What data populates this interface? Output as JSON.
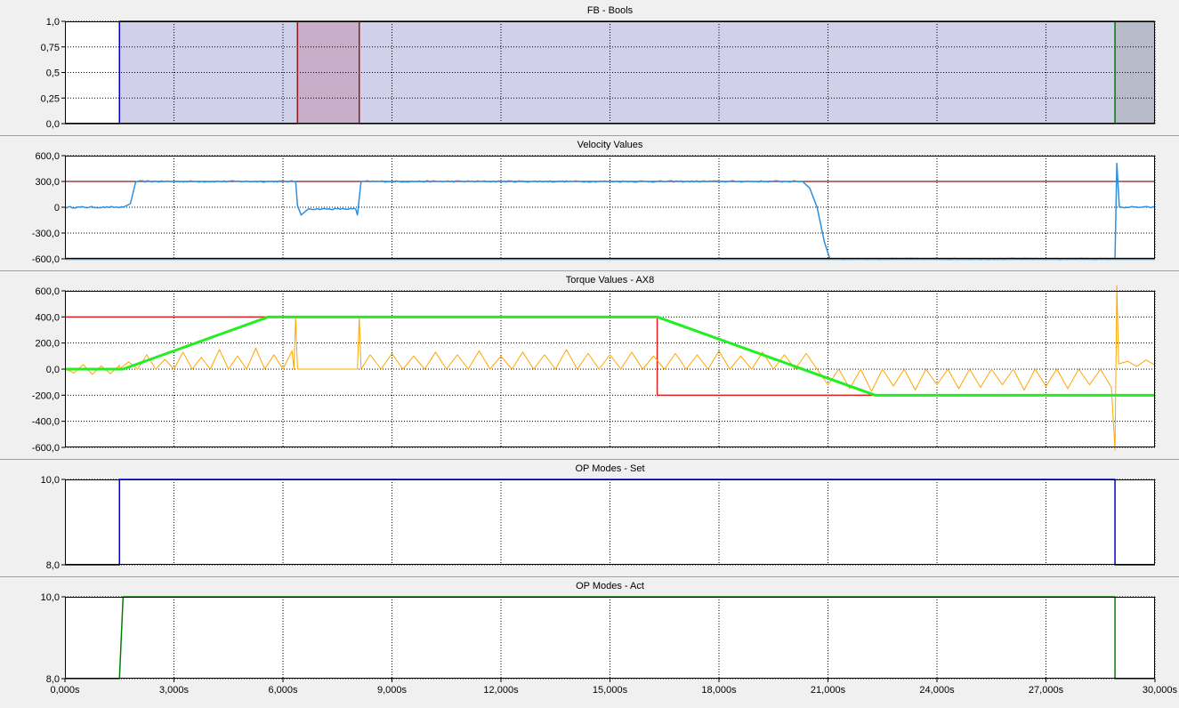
{
  "x_axis": {
    "range": [
      0,
      30
    ],
    "ticks": [
      0,
      3,
      6,
      9,
      12,
      15,
      18,
      21,
      24,
      27,
      30
    ],
    "tick_labels": [
      "0,000s",
      "3,000s",
      "6,000s",
      "9,000s",
      "12,000s",
      "15,000s",
      "18,000s",
      "21,000s",
      "24,000s",
      "27,000s",
      "30,000s"
    ]
  },
  "colors": {
    "panel_bg": "#f0f0f0",
    "plot_bg": "#ffffff",
    "grid": "#000000",
    "blue": "#0000cc",
    "dark_red": "#8b1a1a",
    "green": "#008000",
    "light_blue": "#2a8fe0",
    "red": "#e02020",
    "bright_green": "#22ee22",
    "orange": "#ffa500"
  },
  "chart_data": [
    {
      "type": "line",
      "title": "FB - Bools",
      "ylim": [
        0,
        1
      ],
      "yticks": [
        0,
        0.25,
        0.5,
        0.75,
        1
      ],
      "ytick_labels": [
        "0,0",
        "0,25",
        "0,5",
        "0,75",
        "1,0"
      ],
      "grid": true,
      "series": [
        {
          "color": "blue",
          "fill": "#c8c8e6",
          "points": [
            [
              0,
              0
            ],
            [
              1.5,
              0
            ],
            [
              1.5,
              1
            ],
            [
              30,
              1
            ]
          ]
        },
        {
          "color": "dark_red",
          "fill": "#c8a8c4",
          "points": [
            [
              0,
              0
            ],
            [
              6.4,
              0
            ],
            [
              6.4,
              1
            ],
            [
              8.1,
              1
            ],
            [
              8.1,
              0
            ],
            [
              30,
              0
            ]
          ]
        },
        {
          "color": "green",
          "fill": "#b4b8c4",
          "points": [
            [
              0,
              0
            ],
            [
              28.9,
              0
            ],
            [
              28.9,
              1
            ],
            [
              30,
              1
            ]
          ]
        }
      ]
    },
    {
      "type": "line",
      "title": "Velocity Values",
      "ylim": [
        -600,
        600
      ],
      "yticks": [
        -600,
        -300,
        0,
        300,
        600
      ],
      "ytick_labels": [
        "-600,0",
        "-300,0",
        "0",
        "300,0",
        "600,0"
      ],
      "grid": true,
      "series": [
        {
          "color": "dark_red",
          "width": 1.2,
          "points": [
            [
              0,
              300
            ],
            [
              30,
              300
            ]
          ]
        },
        {
          "color": "light_blue",
          "width": 2.5,
          "points": [
            [
              0,
              -600
            ],
            [
              30,
              -600
            ]
          ]
        },
        {
          "color": "light_blue",
          "width": 1.5,
          "noise": 8,
          "points": [
            [
              0,
              0
            ],
            [
              1.6,
              0
            ],
            [
              1.8,
              40
            ],
            [
              1.95,
              300
            ],
            [
              6.35,
              300
            ],
            [
              6.4,
              20
            ],
            [
              6.5,
              -90
            ],
            [
              6.7,
              -20
            ],
            [
              8,
              -20
            ],
            [
              8.05,
              -90
            ],
            [
              8.15,
              300
            ],
            [
              20.3,
              300
            ],
            [
              20.5,
              220
            ],
            [
              20.7,
              0
            ],
            [
              20.9,
              -400
            ],
            [
              21.05,
              -600
            ],
            [
              28.9,
              -600
            ],
            [
              28.95,
              510
            ],
            [
              29.02,
              0
            ],
            [
              30,
              0
            ]
          ]
        }
      ]
    },
    {
      "type": "line",
      "title": "Torque Values - AX8",
      "ylim": [
        -600,
        600
      ],
      "yticks": [
        -600,
        -400,
        -200,
        0,
        200,
        400,
        600
      ],
      "ytick_labels": [
        "-600,0",
        "-400,0",
        "-200,0",
        "0,0",
        "200,0",
        "400,0",
        "600,0"
      ],
      "grid": true,
      "series": [
        {
          "color": "red",
          "width": 1.5,
          "points": [
            [
              0,
              400
            ],
            [
              16.3,
              400
            ],
            [
              16.3,
              -200
            ],
            [
              30,
              -200
            ]
          ]
        },
        {
          "color": "orange",
          "width": 1,
          "points": [
            [
              0,
              5
            ],
            [
              0.25,
              -30
            ],
            [
              0.5,
              35
            ],
            [
              0.75,
              -40
            ],
            [
              1,
              25
            ],
            [
              1.25,
              -35
            ],
            [
              1.5,
              30
            ],
            [
              1.5,
              0
            ],
            [
              1.75,
              55
            ],
            [
              2,
              0
            ],
            [
              2.25,
              110
            ],
            [
              2.5,
              0
            ],
            [
              2.75,
              75
            ],
            [
              3,
              0
            ],
            [
              3.25,
              130
            ],
            [
              3.5,
              0
            ],
            [
              3.75,
              90
            ],
            [
              4,
              0
            ],
            [
              4.25,
              150
            ],
            [
              4.5,
              0
            ],
            [
              4.75,
              100
            ],
            [
              5,
              0
            ],
            [
              5.25,
              160
            ],
            [
              5.5,
              0
            ],
            [
              5.75,
              110
            ],
            [
              6,
              0
            ],
            [
              6.25,
              140
            ],
            [
              6.3,
              0
            ],
            [
              6.35,
              400
            ],
            [
              6.4,
              0
            ],
            [
              8.05,
              0
            ],
            [
              8.1,
              400
            ],
            [
              8.15,
              0
            ],
            [
              8.4,
              110
            ],
            [
              8.7,
              0
            ],
            [
              9,
              120
            ],
            [
              9.3,
              0
            ],
            [
              9.6,
              100
            ],
            [
              9.9,
              0
            ],
            [
              10.2,
              130
            ],
            [
              10.5,
              0
            ],
            [
              10.8,
              110
            ],
            [
              11.1,
              0
            ],
            [
              11.4,
              140
            ],
            [
              11.7,
              0
            ],
            [
              12,
              100
            ],
            [
              12.3,
              0
            ],
            [
              12.6,
              130
            ],
            [
              12.9,
              0
            ],
            [
              13.2,
              110
            ],
            [
              13.5,
              0
            ],
            [
              13.8,
              150
            ],
            [
              14.1,
              0
            ],
            [
              14.4,
              120
            ],
            [
              14.7,
              0
            ],
            [
              15,
              110
            ],
            [
              15.3,
              0
            ],
            [
              15.6,
              130
            ],
            [
              15.9,
              0
            ],
            [
              16.2,
              100
            ],
            [
              16.5,
              0
            ],
            [
              16.8,
              120
            ],
            [
              17.1,
              0
            ],
            [
              17.4,
              110
            ],
            [
              17.7,
              0
            ],
            [
              18,
              140
            ],
            [
              18.3,
              0
            ],
            [
              18.6,
              100
            ],
            [
              18.9,
              0
            ],
            [
              19.2,
              130
            ],
            [
              19.5,
              0
            ],
            [
              19.8,
              110
            ],
            [
              20.1,
              0
            ],
            [
              20.4,
              120
            ],
            [
              20.7,
              0
            ],
            [
              21,
              -120
            ],
            [
              21.3,
              0
            ],
            [
              21.6,
              -150
            ],
            [
              21.9,
              0
            ],
            [
              22.2,
              -170
            ],
            [
              22.5,
              0
            ],
            [
              22.8,
              -130
            ],
            [
              23.1,
              0
            ],
            [
              23.4,
              -160
            ],
            [
              23.7,
              0
            ],
            [
              24,
              -120
            ],
            [
              24.3,
              0
            ],
            [
              24.6,
              -150
            ],
            [
              24.9,
              0
            ],
            [
              25.2,
              -140
            ],
            [
              25.5,
              0
            ],
            [
              25.8,
              -120
            ],
            [
              26.1,
              0
            ],
            [
              26.4,
              -160
            ],
            [
              26.7,
              0
            ],
            [
              27,
              -130
            ],
            [
              27.3,
              0
            ],
            [
              27.6,
              -150
            ],
            [
              27.9,
              0
            ],
            [
              28.2,
              -120
            ],
            [
              28.5,
              0
            ],
            [
              28.8,
              -140
            ],
            [
              28.9,
              -620
            ],
            [
              28.95,
              640
            ],
            [
              29,
              40
            ],
            [
              29.25,
              60
            ],
            [
              29.5,
              20
            ],
            [
              29.75,
              70
            ],
            [
              30,
              30
            ]
          ]
        },
        {
          "color": "bright_green",
          "width": 3,
          "points": [
            [
              0,
              0
            ],
            [
              1.6,
              0
            ],
            [
              5.6,
              400
            ],
            [
              16.3,
              400
            ],
            [
              22.3,
              -200
            ],
            [
              30,
              -200
            ]
          ]
        }
      ]
    },
    {
      "type": "line",
      "title": "OP Modes - Set",
      "ylim": [
        8,
        10
      ],
      "yticks": [
        8,
        10
      ],
      "ytick_labels": [
        "8,0",
        "10,0"
      ],
      "grid": true,
      "series": [
        {
          "color": "blue",
          "width": 1.5,
          "points": [
            [
              0,
              8
            ],
            [
              1.5,
              8
            ],
            [
              1.5,
              10
            ],
            [
              28.9,
              10
            ],
            [
              28.9,
              8
            ],
            [
              30,
              8
            ]
          ]
        }
      ]
    },
    {
      "type": "line",
      "title": "OP Modes - Act",
      "ylim": [
        8,
        10
      ],
      "yticks": [
        8,
        10
      ],
      "ytick_labels": [
        "8,0",
        "10,0"
      ],
      "grid": true,
      "series": [
        {
          "color": "green",
          "width": 1.5,
          "points": [
            [
              0,
              8
            ],
            [
              1.5,
              8
            ],
            [
              1.6,
              10
            ],
            [
              28.9,
              10
            ],
            [
              28.9,
              8
            ],
            [
              30,
              8
            ]
          ]
        }
      ]
    }
  ]
}
